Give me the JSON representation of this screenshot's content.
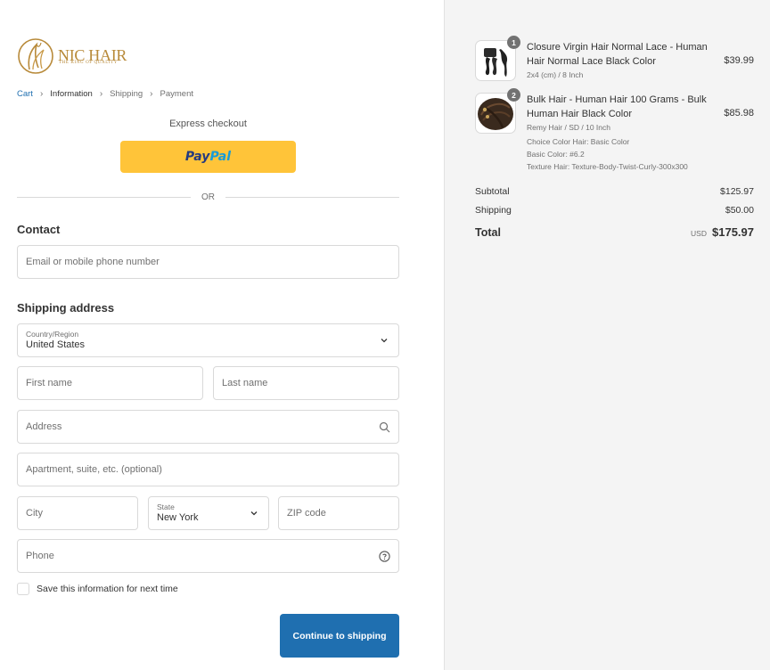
{
  "brand": {
    "name": "NIC HAIR",
    "tagline": "THE KING OF QUALITY",
    "accent": "#b88a3a"
  },
  "breadcrumb": [
    "Cart",
    "Information",
    "Shipping",
    "Payment"
  ],
  "express_checkout": {
    "label": "Express checkout",
    "paypal_pay": "Pay",
    "paypal_pal": "Pal"
  },
  "divider_text": "OR",
  "contact": {
    "title": "Contact",
    "email_placeholder": "Email or mobile phone number"
  },
  "shipping": {
    "title": "Shipping address",
    "country_label": "Country/Region",
    "country_value": "United States",
    "first_name_placeholder": "First name",
    "last_name_placeholder": "Last name",
    "address_placeholder": "Address",
    "apartment_placeholder": "Apartment, suite, etc. (optional)",
    "city_placeholder": "City",
    "state_label": "State",
    "state_value": "New York",
    "zip_placeholder": "ZIP code",
    "phone_placeholder": "Phone",
    "save_info_label": "Save this information for next time",
    "continue_label": "Continue to shipping"
  },
  "colors": {
    "primary": "#1f6fb0",
    "paypal_yellow": "#ffc439"
  },
  "order": {
    "items": [
      {
        "quantity": "1",
        "title": "Closure Virgin Hair Normal Lace - Human Hair Normal Lace Black Color",
        "variant": "2x4 (cm) / 8 Inch",
        "price": "$39.99"
      },
      {
        "quantity": "2",
        "title": "Bulk Hair - Human Hair 100 Grams - Bulk Human Hair Black Color",
        "variant": "Remy Hair / SD / 10 Inch",
        "extra": [
          "Choice Color Hair: Basic Color",
          "Basic Color: #6.2",
          "Texture Hair: Texture-Body-Twist-Curly-300x300"
        ],
        "price": "$85.98"
      }
    ],
    "subtotal_label": "Subtotal",
    "subtotal_value": "$125.97",
    "shipping_label": "Shipping",
    "shipping_value": "$50.00",
    "total_label": "Total",
    "currency": "USD",
    "total_value": "$175.97"
  }
}
